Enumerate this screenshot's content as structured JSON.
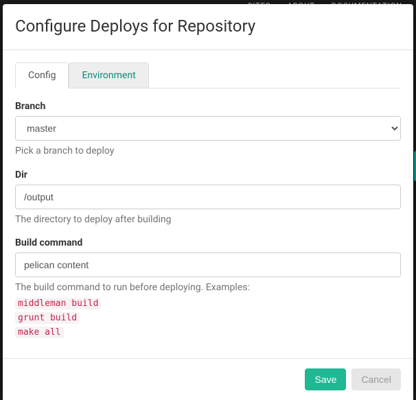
{
  "topnav": {
    "sites": "SITES",
    "about": "ABOUT",
    "docs": "DOCUMENTATION"
  },
  "modal": {
    "title": "Configure Deploys for Repository",
    "tabs": {
      "config": "Config",
      "environment": "Environment"
    },
    "branch": {
      "label": "Branch",
      "value": "master",
      "help": "Pick a branch to deploy"
    },
    "dir": {
      "label": "Dir",
      "value": "/output",
      "help": "The directory to deploy after building"
    },
    "build": {
      "label": "Build command",
      "value": "pelican content",
      "help": "The build command to run before deploying. Examples:",
      "examples": [
        "middleman build",
        "grunt build",
        "make all"
      ]
    },
    "buttons": {
      "save": "Save",
      "cancel": "Cancel"
    }
  }
}
